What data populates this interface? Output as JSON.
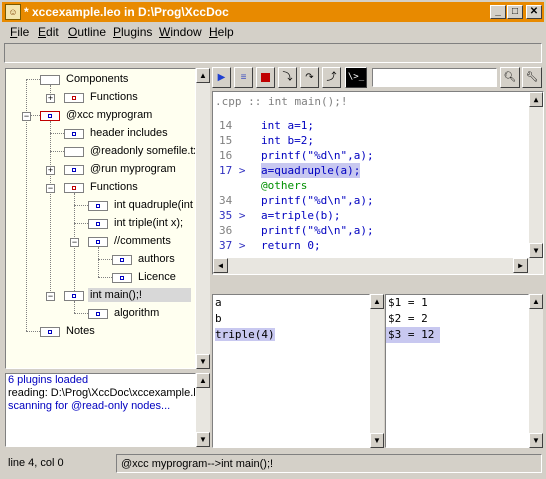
{
  "window": {
    "title": "* xccexample.leo in D:\\Prog\\XccDoc",
    "min_label": "_",
    "max_label": "□",
    "close_label": "✕"
  },
  "menu": [
    "File",
    "Edit",
    "Outline",
    "Plugins",
    "Window",
    "Help"
  ],
  "toolbar": {
    "search_value": "",
    "search_icon": "magnifier-icon",
    "settings_icon": "wrench-icon",
    "buttons": [
      "play-icon",
      "list-icon",
      "stop-icon",
      "step-into-icon",
      "step-over-icon",
      "step-out-icon",
      "terminal-icon"
    ],
    "terminal_label": "\\>_"
  },
  "tree": {
    "nodes": [
      {
        "label": "Components"
      },
      {
        "label": "Functions"
      },
      {
        "label": "@xcc myprogram"
      },
      {
        "label": "header includes"
      },
      {
        "label": "@readonly somefile.txt"
      },
      {
        "label": "@run myprogram"
      },
      {
        "label": "Functions"
      },
      {
        "label": "int quadruple(int x);"
      },
      {
        "label": "int triple(int x);"
      },
      {
        "label": "//comments"
      },
      {
        "label": "authors"
      },
      {
        "label": "Licence"
      },
      {
        "label": "int main();!"
      },
      {
        "label": "algorithm"
      },
      {
        "label": "Notes"
      }
    ]
  },
  "log": [
    "6 plugins loaded",
    "reading: D:\\Prog\\XccDoc\\xccexample.leo",
    "scanning for @read-only nodes..."
  ],
  "editor": {
    "header": ".cpp  :: int main();!",
    "lines": [
      {
        "num": "14",
        "text": "int a=1;"
      },
      {
        "num": "15",
        "text": "int b=2;"
      },
      {
        "num": "16",
        "text": "printf(\"%d\\n\",a);"
      },
      {
        "num": "17 >",
        "text": "a=quadruple(a);"
      },
      {
        "num": "",
        "text": "@others"
      },
      {
        "num": "34",
        "text": "printf(\"%d\\n\",a);"
      },
      {
        "num": "35 >",
        "text": "a=triple(b);"
      },
      {
        "num": "36",
        "text": "printf(\"%d\\n\",a);"
      },
      {
        "num": "37 >",
        "text": "return 0;"
      }
    ]
  },
  "watch_left": [
    "a",
    "b",
    "triple(4)"
  ],
  "watch_right": [
    "$1 = 1",
    "$2 = 2",
    "$3 = 12"
  ],
  "status": {
    "position": "line 4, col 0",
    "path": "@xcc myprogram-->int main();!"
  },
  "colors": {
    "title_bar": "#e88a00",
    "tree_bg": "#fffff0",
    "log_text": "#0000c0",
    "highlight": "#c8c8f0",
    "directive": "#009000"
  }
}
